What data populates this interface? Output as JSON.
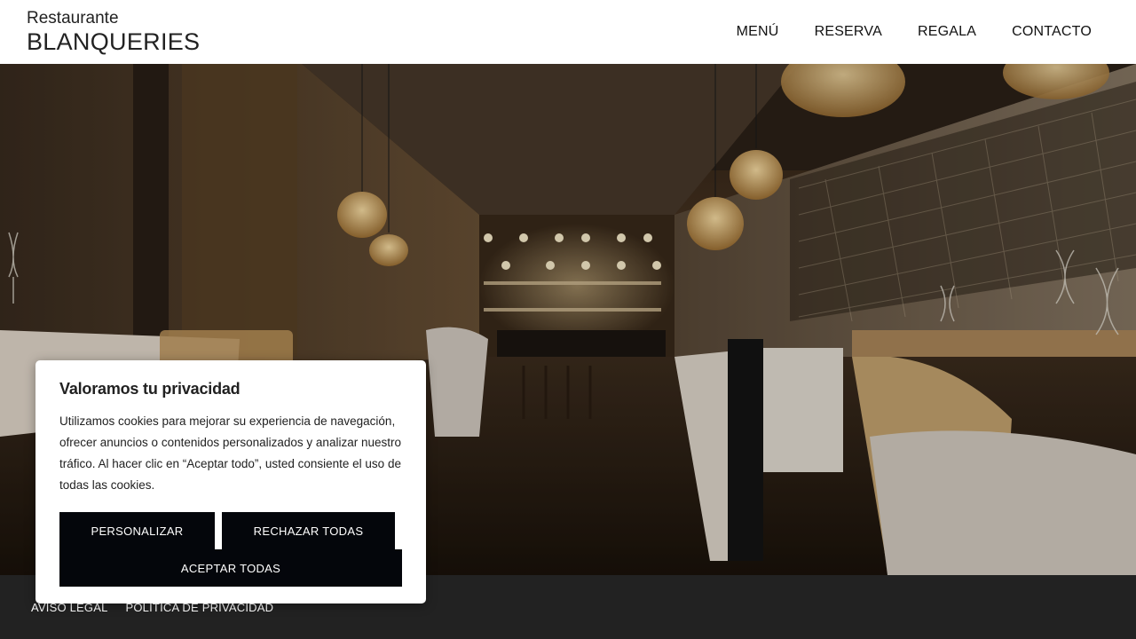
{
  "header": {
    "logo_small": "Restaurante",
    "logo_main": "BLANQUERIES",
    "nav": [
      {
        "label": "MENÚ"
      },
      {
        "label": "RESERVA"
      },
      {
        "label": "REGALA"
      },
      {
        "label": "CONTACTO"
      }
    ]
  },
  "footer": {
    "links": [
      {
        "label": "AVISO LEGAL"
      },
      {
        "label": "POLÍTICA DE PRIVACIDAD"
      }
    ]
  },
  "cookie": {
    "title": "Valoramos tu privacidad",
    "text": "Utilizamos cookies para mejorar su experiencia de navegación, ofrecer anuncios o contenidos personalizados y analizar nuestro tráfico. Al hacer clic en “Aceptar todo”, usted consiente el uso de todas las cookies.",
    "buttons": {
      "customize": "PERSONALIZAR",
      "reject": "RECHAZAR TODAS",
      "accept": "ACEPTAR TODAS"
    }
  },
  "colors": {
    "button_bg": "#04060b",
    "footer_bg": "#222222",
    "header_bg": "#ffffff"
  }
}
